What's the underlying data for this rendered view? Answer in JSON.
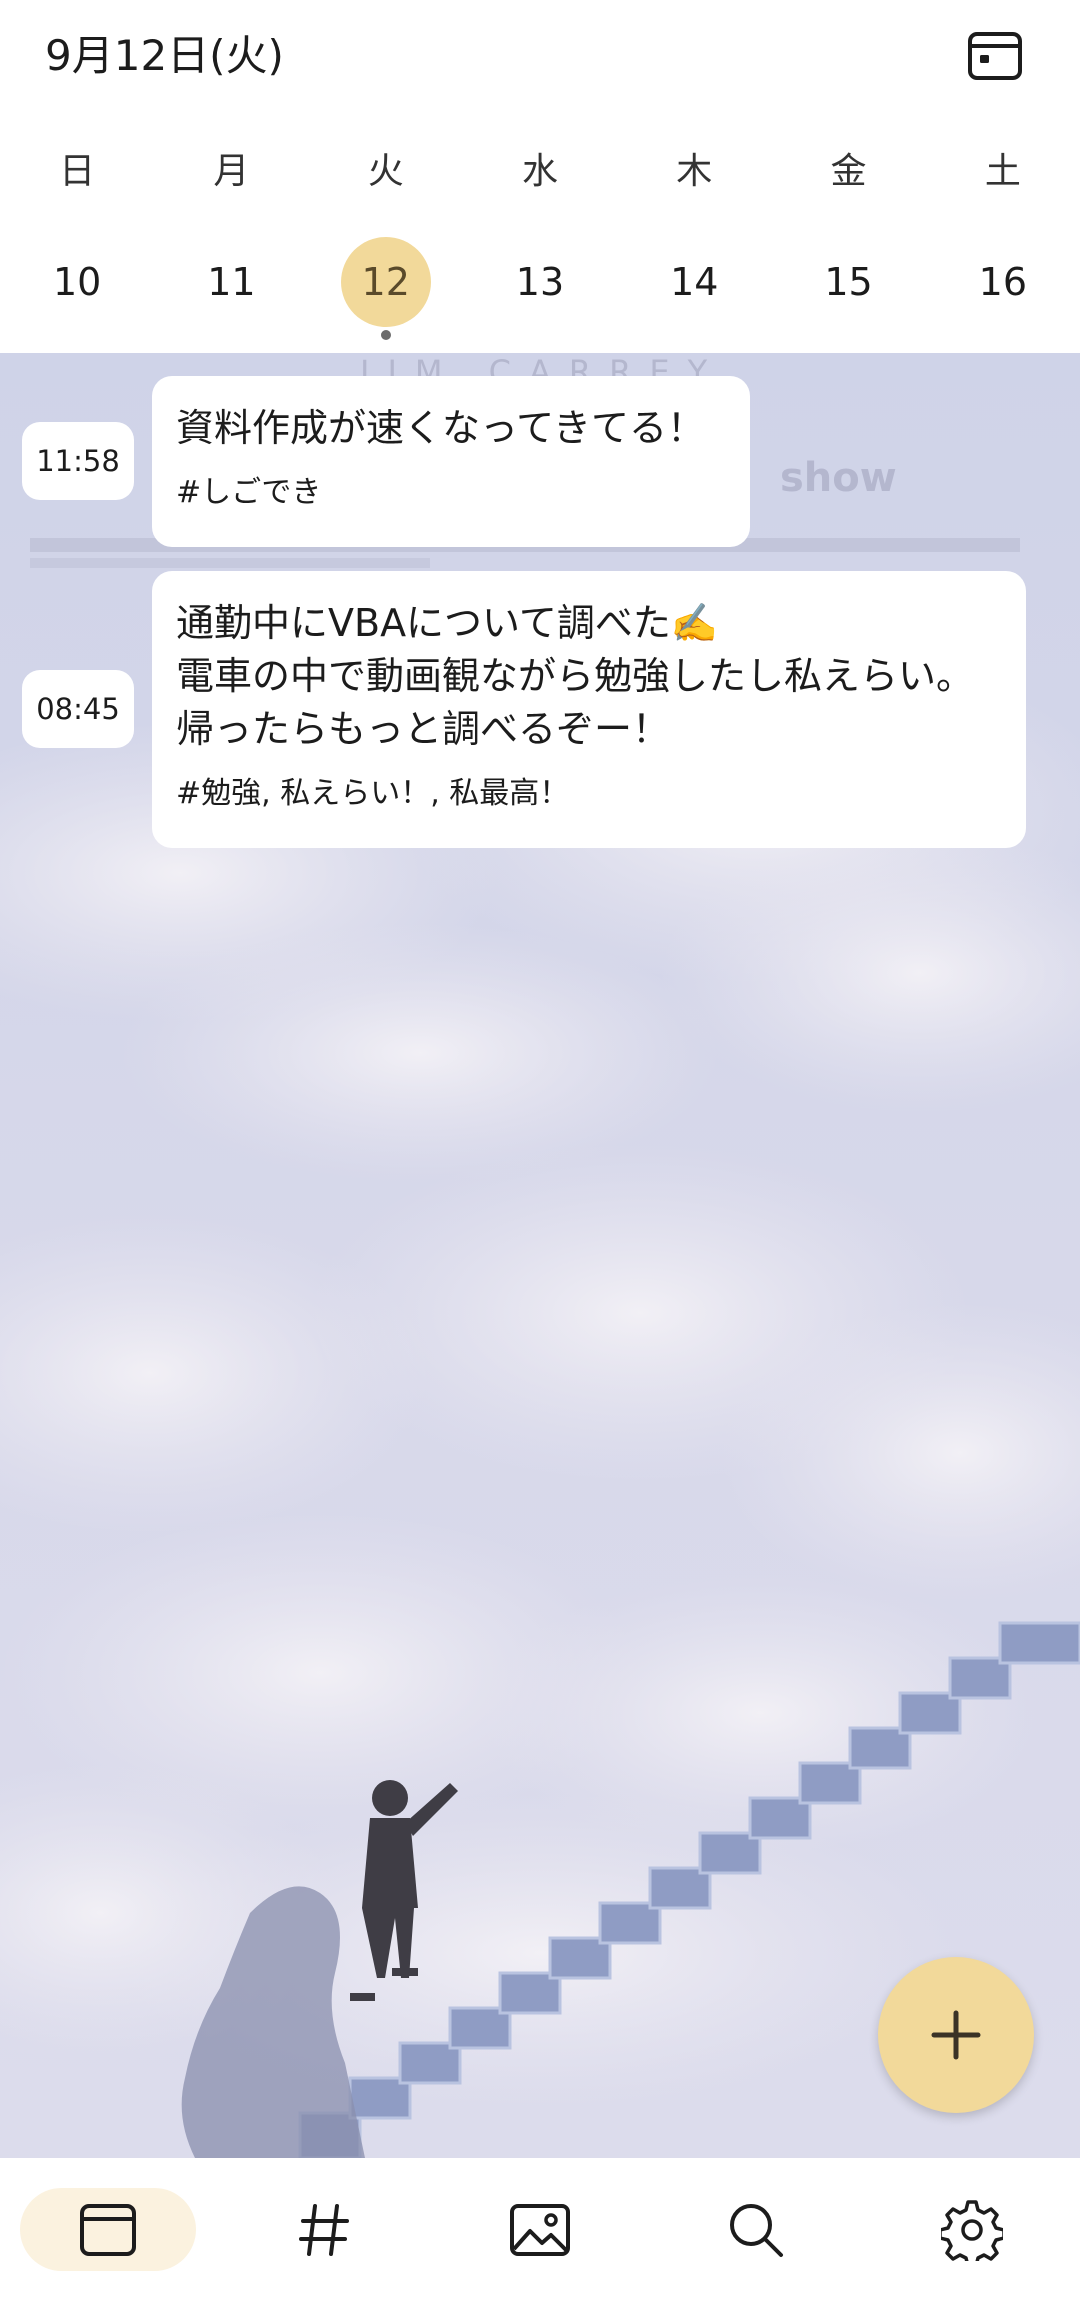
{
  "header": {
    "date_title": "9月12日(火)",
    "calendar_icon": "calendar-icon"
  },
  "week": {
    "weekdays": [
      "日",
      "月",
      "火",
      "水",
      "木",
      "金",
      "土"
    ],
    "days": [
      "10",
      "11",
      "12",
      "13",
      "14",
      "15",
      "16"
    ],
    "selected_index": 2,
    "selected_color": "#f2d99a"
  },
  "entries": [
    {
      "time": "11:58",
      "text": "資料作成が速くなってきてる！",
      "tags": "#しごでき"
    },
    {
      "time": "08:45",
      "text": "通勤中にVBAについて調べた✍️\n電車の中で動画観ながら勉強したし私えらい。\n帰ったらもっと調べるぞー！",
      "tags": "#勉強, 私えらい！, 私最高！"
    }
  ],
  "background": {
    "description_words": [
      "JIM CARREY",
      "show"
    ]
  },
  "fab": {
    "icon": "plus-icon",
    "color": "#f2d99a"
  },
  "bottom_nav": {
    "items": [
      {
        "icon": "calendar-icon",
        "active": true
      },
      {
        "icon": "hashtag-icon",
        "active": false
      },
      {
        "icon": "image-icon",
        "active": false
      },
      {
        "icon": "search-icon",
        "active": false
      },
      {
        "icon": "settings-gear-icon",
        "active": false
      }
    ],
    "active_color": "#fbf2df"
  }
}
